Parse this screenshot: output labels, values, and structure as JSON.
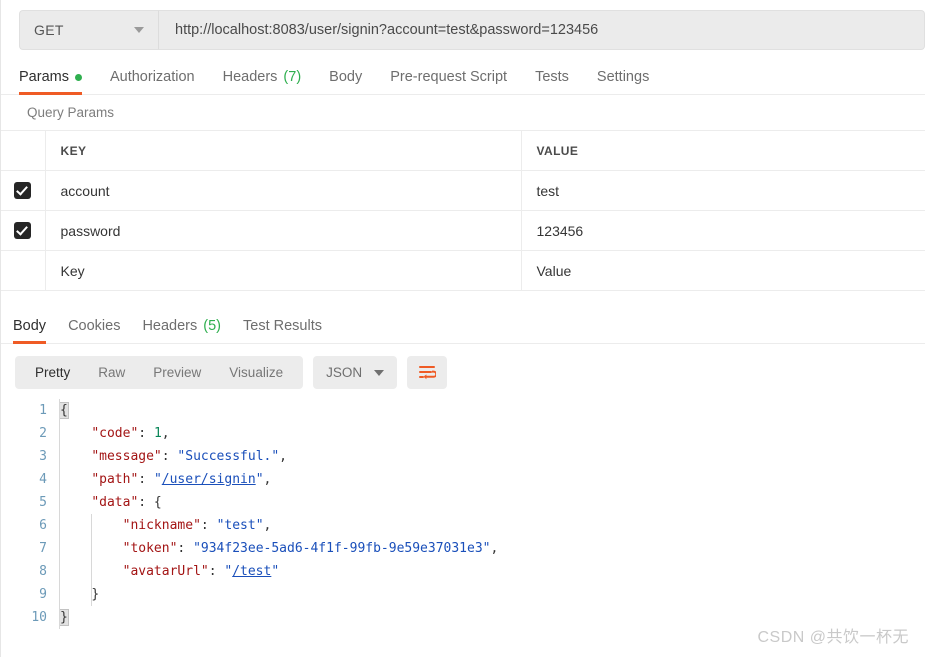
{
  "request": {
    "method": "GET",
    "method_caret_icon": "chevron-down-icon",
    "url": "http://localhost:8083/user/signin?account=test&password=123456",
    "tabs": [
      {
        "label": "Params",
        "badge": "",
        "dot": true,
        "active": true
      },
      {
        "label": "Authorization",
        "badge": "",
        "dot": false,
        "active": false
      },
      {
        "label": "Headers",
        "badge": "(7)",
        "dot": false,
        "active": false
      },
      {
        "label": "Body",
        "badge": "",
        "dot": false,
        "active": false
      },
      {
        "label": "Pre-request Script",
        "badge": "",
        "dot": false,
        "active": false
      },
      {
        "label": "Tests",
        "badge": "",
        "dot": false,
        "active": false
      },
      {
        "label": "Settings",
        "badge": "",
        "dot": false,
        "active": false
      }
    ]
  },
  "params": {
    "section_title": "Query Params",
    "columns": [
      "KEY",
      "VALUE"
    ],
    "rows": [
      {
        "checked": true,
        "key": "account",
        "value": "test"
      },
      {
        "checked": true,
        "key": "password",
        "value": "123456"
      }
    ],
    "new_row": {
      "key_placeholder": "Key",
      "value_placeholder": "Value"
    }
  },
  "response": {
    "tabs": [
      {
        "label": "Body",
        "badge": "",
        "active": true
      },
      {
        "label": "Cookies",
        "badge": "",
        "active": false
      },
      {
        "label": "Headers",
        "badge": "(5)",
        "active": false
      },
      {
        "label": "Test Results",
        "badge": "",
        "active": false
      }
    ],
    "view_modes": [
      {
        "label": "Pretty",
        "active": true
      },
      {
        "label": "Raw",
        "active": false
      },
      {
        "label": "Preview",
        "active": false
      },
      {
        "label": "Visualize",
        "active": false
      }
    ],
    "format": "JSON",
    "format_caret_icon": "chevron-down-icon",
    "wrap_icon": "wrap-text-icon",
    "line_numbers": [
      "1",
      "2",
      "3",
      "4",
      "5",
      "6",
      "7",
      "8",
      "9",
      "10"
    ],
    "body_json": {
      "code": 1,
      "message": "Successful.",
      "path": "/user/signin",
      "data": {
        "nickname": "test",
        "token": "934f23ee-5ad6-4f1f-99fb-9e59e37031e3",
        "avatarUrl": "/test"
      }
    },
    "code_lines": [
      {
        "indent": 0,
        "tokens": [
          {
            "t": "brace-open",
            "v": "{"
          }
        ]
      },
      {
        "indent": 1,
        "tokens": [
          {
            "t": "key",
            "v": "\"code\""
          },
          {
            "t": "punct",
            "v": ": "
          },
          {
            "t": "num",
            "v": "1"
          },
          {
            "t": "punct",
            "v": ","
          }
        ]
      },
      {
        "indent": 1,
        "tokens": [
          {
            "t": "key",
            "v": "\"message\""
          },
          {
            "t": "punct",
            "v": ": "
          },
          {
            "t": "str",
            "v": "\"Successful.\""
          },
          {
            "t": "punct",
            "v": ","
          }
        ]
      },
      {
        "indent": 1,
        "tokens": [
          {
            "t": "key",
            "v": "\"path\""
          },
          {
            "t": "punct",
            "v": ": "
          },
          {
            "t": "str",
            "v": "\""
          },
          {
            "t": "link",
            "v": "/user/signin"
          },
          {
            "t": "str",
            "v": "\""
          },
          {
            "t": "punct",
            "v": ","
          }
        ]
      },
      {
        "indent": 1,
        "tokens": [
          {
            "t": "key",
            "v": "\"data\""
          },
          {
            "t": "punct",
            "v": ": {"
          }
        ]
      },
      {
        "indent": 2,
        "tokens": [
          {
            "t": "key",
            "v": "\"nickname\""
          },
          {
            "t": "punct",
            "v": ": "
          },
          {
            "t": "str",
            "v": "\"test\""
          },
          {
            "t": "punct",
            "v": ","
          }
        ]
      },
      {
        "indent": 2,
        "tokens": [
          {
            "t": "key",
            "v": "\"token\""
          },
          {
            "t": "punct",
            "v": ": "
          },
          {
            "t": "str",
            "v": "\"934f23ee-5ad6-4f1f-99fb-9e59e37031e3\""
          },
          {
            "t": "punct",
            "v": ","
          }
        ]
      },
      {
        "indent": 2,
        "tokens": [
          {
            "t": "key",
            "v": "\"avatarUrl\""
          },
          {
            "t": "punct",
            "v": ": "
          },
          {
            "t": "str",
            "v": "\""
          },
          {
            "t": "link",
            "v": "/test"
          },
          {
            "t": "str",
            "v": "\""
          }
        ]
      },
      {
        "indent": 1,
        "tokens": [
          {
            "t": "punct",
            "v": "}"
          }
        ]
      },
      {
        "indent": 0,
        "tokens": [
          {
            "t": "brace-close",
            "v": "}"
          }
        ]
      }
    ]
  },
  "watermark": "CSDN @共饮一杯无",
  "colors": {
    "accent": "#ef5b25",
    "green": "#2faf4f",
    "json_key": "#a31515",
    "json_string": "#1a4fba",
    "json_number": "#098658",
    "gutter": "#6c9ab8",
    "toolbar_bg": "#ececec"
  }
}
